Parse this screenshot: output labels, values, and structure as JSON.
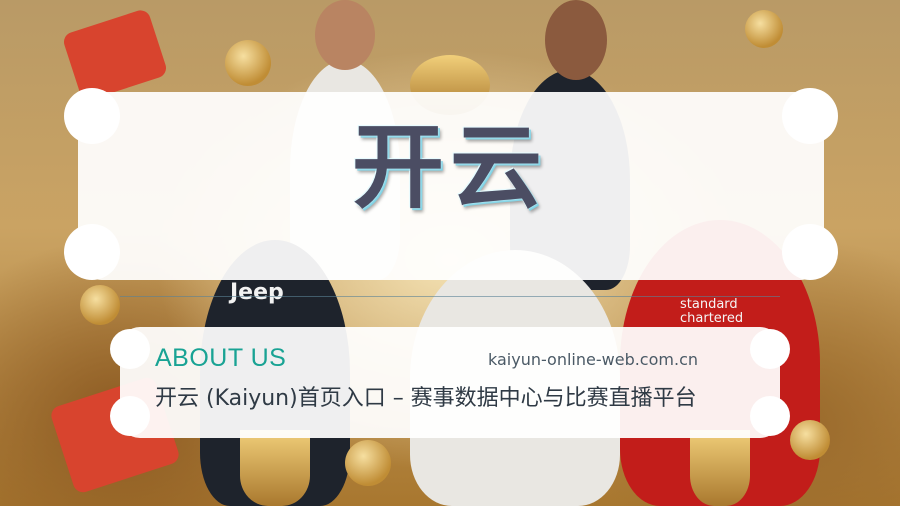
{
  "brand": {
    "title": "开云"
  },
  "about": {
    "label": "ABOUT US",
    "site_url": "kaiyun-online-web.com.cn",
    "description": "开云 (Kaiyun)首页入口 – 赛事数据中心与比赛直播平台"
  },
  "background": {
    "jersey_texts": [
      "Jeep",
      "standard chartered"
    ],
    "theme_colors": {
      "gold": "#c9a25f",
      "accent_teal": "#19a394",
      "title_ink": "#4b4d63"
    }
  }
}
